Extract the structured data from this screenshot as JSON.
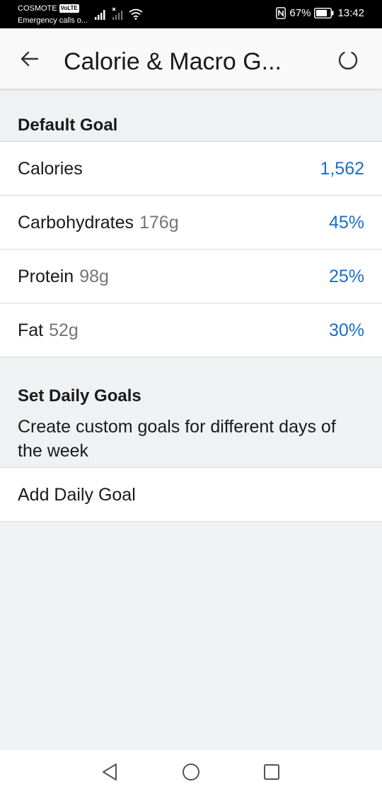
{
  "status_bar": {
    "carrier": "COSMOTE",
    "volte": "VoLTE",
    "emergency": "Emergency calls o...",
    "battery": "67%",
    "time": "13:42"
  },
  "app_bar": {
    "title": "Calorie & Macro G..."
  },
  "default_goal": {
    "heading": "Default Goal",
    "rows": [
      {
        "label": "Calories",
        "sub": "",
        "value": "1,562"
      },
      {
        "label": "Carbohydrates",
        "sub": "176g",
        "value": "45%"
      },
      {
        "label": "Protein",
        "sub": "98g",
        "value": "25%"
      },
      {
        "label": "Fat",
        "sub": "52g",
        "value": "30%"
      }
    ]
  },
  "daily_goals": {
    "heading": "Set Daily Goals",
    "description": "Create custom goals for different days of the week",
    "add_label": "Add Daily Goal"
  },
  "colors": {
    "accent": "#1a6fc9",
    "background": "#f0f1f3"
  },
  "icons": [
    "back-arrow-icon",
    "refresh-icon",
    "nav-back-icon",
    "nav-home-icon",
    "nav-recents-icon"
  ]
}
